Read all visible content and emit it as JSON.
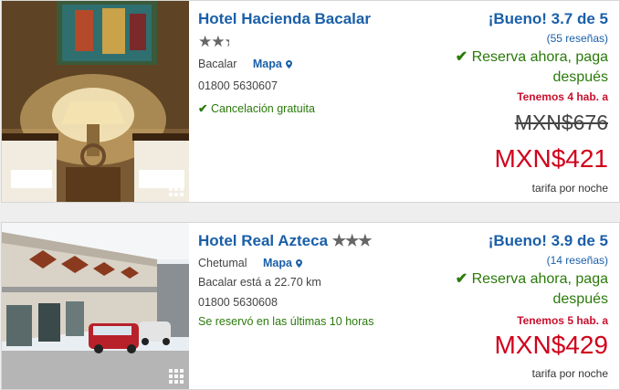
{
  "hotels": [
    {
      "name": "Hotel Hacienda Bacalar",
      "stars": "★★",
      "half_star": "★",
      "location": "Bacalar",
      "map_label": "Mapa",
      "phone": "01800 5630607",
      "feature": "Cancelación gratuita",
      "rating": "¡Bueno! 3.7 de 5",
      "reviews": "(55 reseñas)",
      "reserve": "Reserva ahora, paga después",
      "rooms_left": "Tenemos 4 hab. a",
      "old_price": "MXN$676",
      "price": "MXN$421",
      "per_night": "tarifa por noche"
    },
    {
      "name": "Hotel Real Azteca",
      "stars": "★★★",
      "location": "Chetumal",
      "map_label": "Mapa",
      "distance": "Bacalar está a 22.70 km",
      "phone": "01800 5630608",
      "feature": "Se reservó en las últimas 10 horas",
      "rating": "¡Bueno! 3.9 de 5",
      "reviews": "(14 reseñas)",
      "reserve": "Reserva ahora, paga después",
      "rooms_left": "Tenemos 5 hab. a",
      "price": "MXN$429",
      "per_night": "tarifa por noche"
    }
  ],
  "icons": {
    "check": "check-icon",
    "map_pin": "map-pin-icon",
    "gallery": "gallery-grid-icon"
  },
  "colors": {
    "link_blue": "#1a5fa8",
    "green": "#2b7a0b",
    "price_red": "#d0021b"
  }
}
